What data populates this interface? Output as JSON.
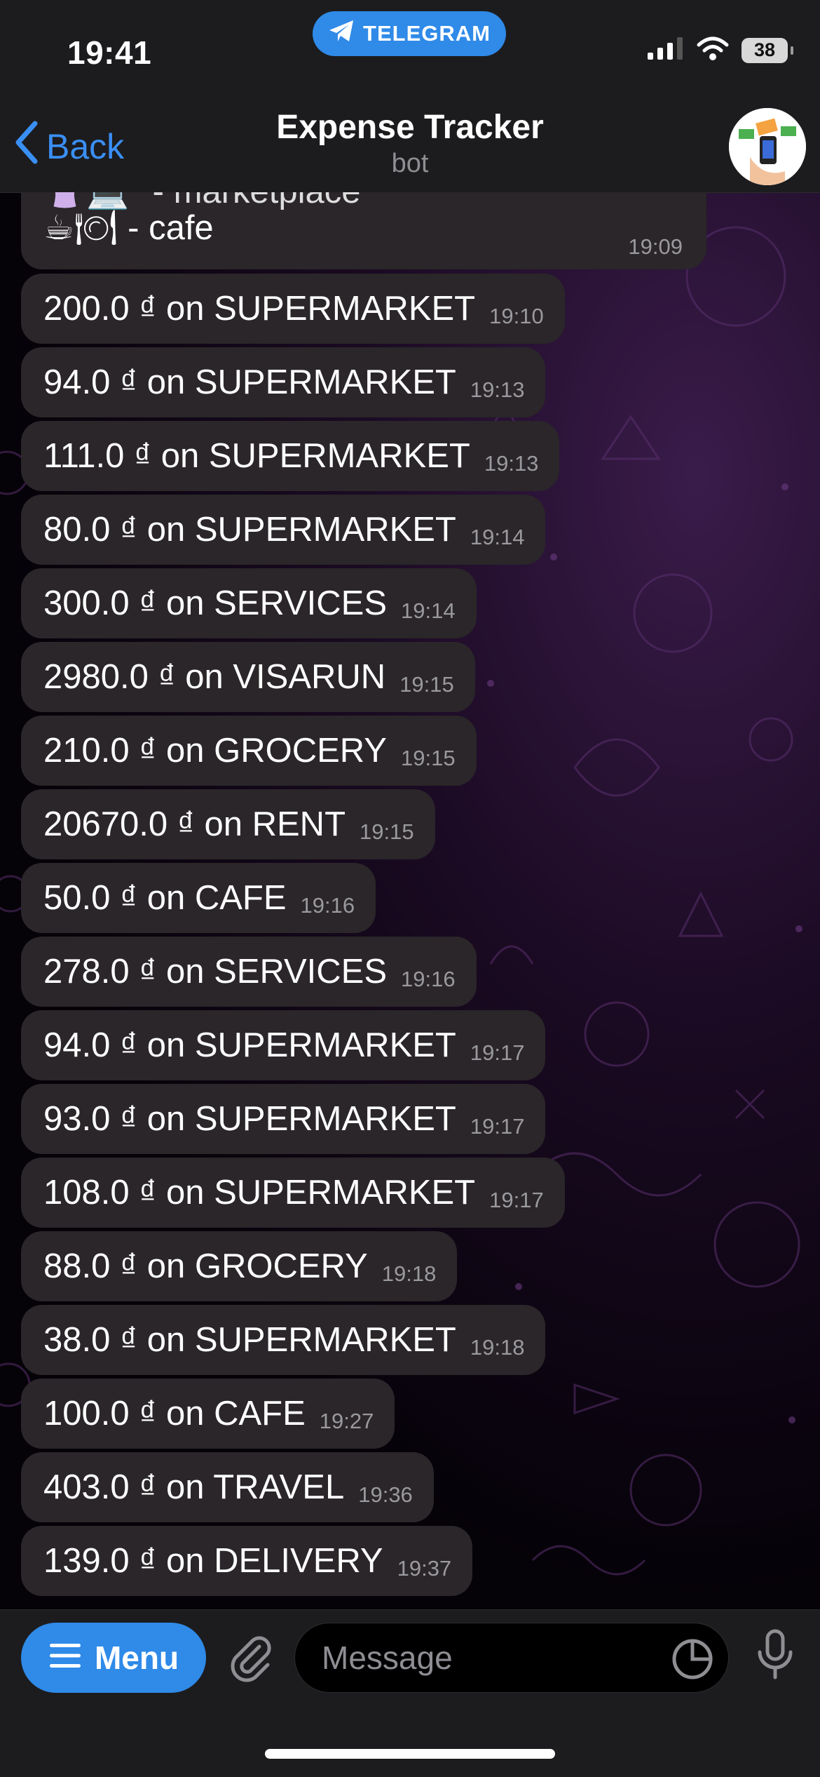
{
  "status_bar": {
    "time": "19:41",
    "pill_label": "TELEGRAM",
    "battery": "38"
  },
  "header": {
    "back_label": "Back",
    "title": "Expense Tracker",
    "subtitle": "bot"
  },
  "first_message": {
    "line1": "- marketplace",
    "line2": "- cafe",
    "time": "19:09",
    "emoji1": "☕🍽",
    "emoji0": "👚💻"
  },
  "messages": [
    {
      "text": "200.0 ₫ on SUPERMARKET",
      "time": "19:10"
    },
    {
      "text": "94.0 ₫ on SUPERMARKET",
      "time": "19:13"
    },
    {
      "text": "111.0 ₫ on SUPERMARKET",
      "time": "19:13"
    },
    {
      "text": "80.0 ₫ on SUPERMARKET",
      "time": "19:14"
    },
    {
      "text": "300.0 ₫ on SERVICES",
      "time": "19:14"
    },
    {
      "text": "2980.0 ₫ on VISARUN",
      "time": "19:15"
    },
    {
      "text": "210.0 ₫ on GROCERY",
      "time": "19:15"
    },
    {
      "text": "20670.0 ₫ on RENT",
      "time": "19:15"
    },
    {
      "text": "50.0 ₫ on CAFE",
      "time": "19:16"
    },
    {
      "text": "278.0 ₫ on SERVICES",
      "time": "19:16"
    },
    {
      "text": "94.0 ₫ on SUPERMARKET",
      "time": "19:17"
    },
    {
      "text": "93.0 ₫ on SUPERMARKET",
      "time": "19:17"
    },
    {
      "text": "108.0 ₫ on SUPERMARKET",
      "time": "19:17"
    },
    {
      "text": "88.0 ₫ on GROCERY",
      "time": "19:18"
    },
    {
      "text": "38.0 ₫ on SUPERMARKET",
      "time": "19:18"
    },
    {
      "text": "100.0 ₫ on CAFE",
      "time": "19:27"
    },
    {
      "text": "403.0 ₫ on TRAVEL",
      "time": "19:36"
    },
    {
      "text": "139.0 ₫ on DELIVERY",
      "time": "19:37"
    }
  ],
  "bottom_bar": {
    "menu_label": "Menu",
    "message_placeholder": "Message"
  },
  "colors": {
    "accent": "#2f8ae8",
    "bubble": "#2a2629",
    "header": "#1c1c1e"
  }
}
